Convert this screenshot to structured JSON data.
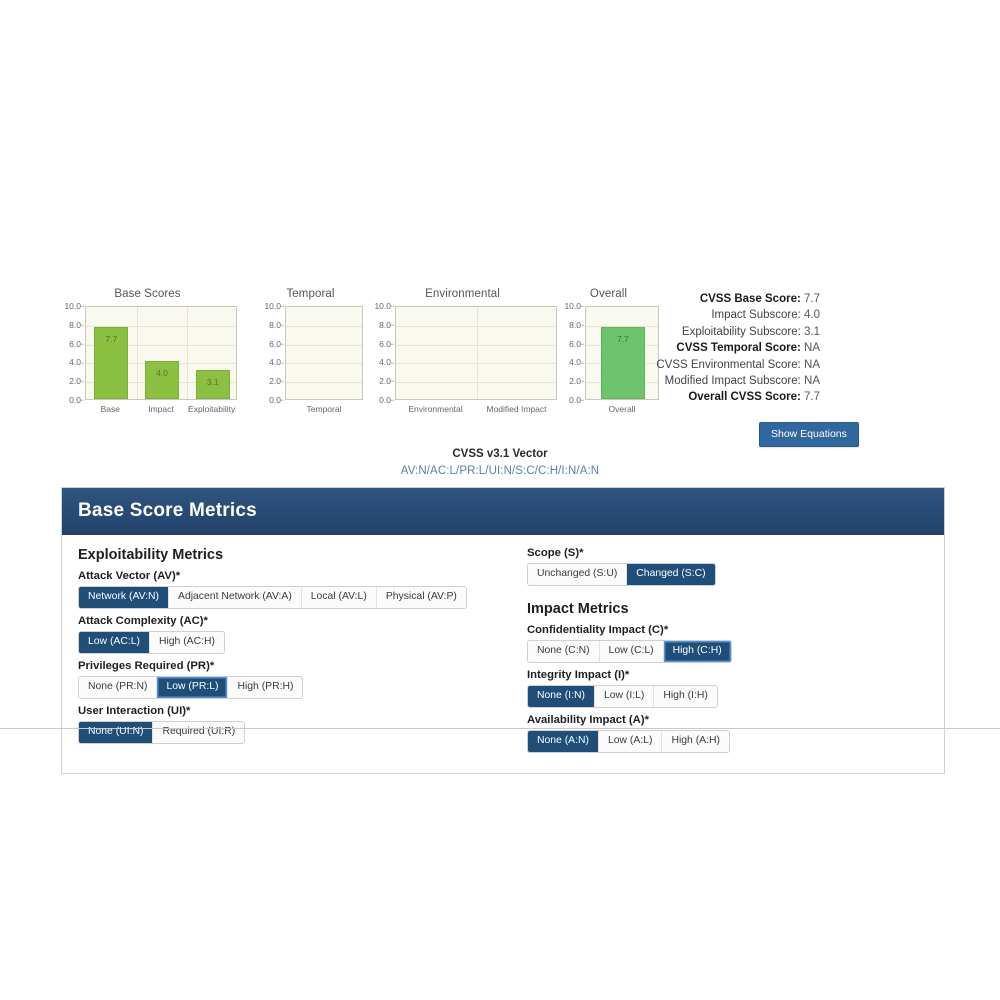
{
  "charts": {
    "yticks": [
      "10.0",
      "8.0",
      "6.0",
      "4.0",
      "2.0",
      "0.0"
    ],
    "panels": [
      {
        "title": "Base Scores",
        "categories": [
          "Base",
          "Impact",
          "Exploitability"
        ],
        "values": [
          7.7,
          4.0,
          3.1
        ],
        "labels": [
          "7.7",
          "4.0",
          "3.1"
        ]
      },
      {
        "title": "Temporal",
        "categories": [
          "Temporal"
        ],
        "values": [],
        "labels": []
      },
      {
        "title": "Environmental",
        "categories": [
          "Environmental",
          "Modified Impact"
        ],
        "values": [],
        "labels": []
      },
      {
        "title": "Overall",
        "categories": [
          "Overall"
        ],
        "values": [
          7.7
        ],
        "labels": [
          "7.7"
        ]
      }
    ]
  },
  "chart_data": [
    {
      "type": "bar",
      "title": "Base Scores",
      "categories": [
        "Base",
        "Impact",
        "Exploitability"
      ],
      "values": [
        7.7,
        4.0,
        3.1
      ],
      "xlabel": "",
      "ylabel": "",
      "ylim": [
        0,
        10
      ],
      "yticks": [
        0,
        2,
        4,
        6,
        8,
        10
      ],
      "grid": true,
      "legend": "none",
      "bar_color": "#8cc041",
      "data_labels": [
        "7.7",
        "4.0",
        "3.1"
      ]
    },
    {
      "type": "bar",
      "title": "Temporal",
      "categories": [
        "Temporal"
      ],
      "values": [],
      "xlabel": "",
      "ylabel": "",
      "ylim": [
        0,
        10
      ],
      "yticks": [
        0,
        2,
        4,
        6,
        8,
        10
      ],
      "grid": true,
      "legend": "none",
      "data_labels": []
    },
    {
      "type": "bar",
      "title": "Environmental",
      "categories": [
        "Environmental",
        "Modified Impact"
      ],
      "values": [],
      "xlabel": "",
      "ylabel": "",
      "ylim": [
        0,
        10
      ],
      "yticks": [
        0,
        2,
        4,
        6,
        8,
        10
      ],
      "grid": true,
      "legend": "none",
      "data_labels": []
    },
    {
      "type": "bar",
      "title": "Overall",
      "categories": [
        "Overall"
      ],
      "values": [
        7.7
      ],
      "xlabel": "",
      "ylabel": "",
      "ylim": [
        0,
        10
      ],
      "yticks": [
        0,
        2,
        4,
        6,
        8,
        10
      ],
      "grid": true,
      "legend": "none",
      "bar_color": "#6dc46d",
      "data_labels": [
        "7.7"
      ]
    }
  ],
  "scores": [
    {
      "label": "CVSS Base Score:",
      "value": "7.7",
      "bold": true
    },
    {
      "label": "Impact Subscore:",
      "value": "4.0",
      "bold": false
    },
    {
      "label": "Exploitability Subscore:",
      "value": "3.1",
      "bold": false
    },
    {
      "label": "CVSS Temporal Score:",
      "value": "NA",
      "bold": true
    },
    {
      "label": "CVSS Environmental Score:",
      "value": "NA",
      "bold": false
    },
    {
      "label": "Modified Impact Subscore:",
      "value": "NA",
      "bold": false
    },
    {
      "label": "Overall CVSS Score:",
      "value": "7.7",
      "bold": true
    }
  ],
  "show_equations_label": "Show Equations",
  "vector": {
    "title": "CVSS v3.1 Vector",
    "value": "AV:N/AC:L/PR:L/UI:N/S:C/C:H/I:N/A:N"
  },
  "panel": {
    "header": "Base Score Metrics",
    "left": {
      "section": "Exploitability Metrics",
      "metrics": [
        {
          "label": "Attack Vector (AV)*",
          "options": [
            {
              "text": "Network (AV:N)",
              "selected": true,
              "focused": false
            },
            {
              "text": "Adjacent Network (AV:A)",
              "selected": false,
              "focused": false
            },
            {
              "text": "Local (AV:L)",
              "selected": false,
              "focused": false
            },
            {
              "text": "Physical (AV:P)",
              "selected": false,
              "focused": false
            }
          ]
        },
        {
          "label": "Attack Complexity (AC)*",
          "options": [
            {
              "text": "Low (AC:L)",
              "selected": true,
              "focused": false
            },
            {
              "text": "High (AC:H)",
              "selected": false,
              "focused": false
            }
          ]
        },
        {
          "label": "Privileges Required (PR)*",
          "options": [
            {
              "text": "None (PR:N)",
              "selected": false,
              "focused": false
            },
            {
              "text": "Low (PR:L)",
              "selected": true,
              "focused": true
            },
            {
              "text": "High (PR:H)",
              "selected": false,
              "focused": false
            }
          ]
        },
        {
          "label": "User Interaction (UI)*",
          "options": [
            {
              "text": "None (UI:N)",
              "selected": true,
              "focused": false
            },
            {
              "text": "Required (UI:R)",
              "selected": false,
              "focused": false
            }
          ]
        }
      ]
    },
    "right": {
      "scope": {
        "label": "Scope (S)*",
        "options": [
          {
            "text": "Unchanged (S:U)",
            "selected": false,
            "focused": false
          },
          {
            "text": "Changed (S:C)",
            "selected": true,
            "focused": false
          }
        ]
      },
      "section": "Impact Metrics",
      "metrics": [
        {
          "label": "Confidentiality Impact (C)*",
          "options": [
            {
              "text": "None (C:N)",
              "selected": false,
              "focused": false
            },
            {
              "text": "Low (C:L)",
              "selected": false,
              "focused": false
            },
            {
              "text": "High (C:H)",
              "selected": true,
              "focused": true
            }
          ]
        },
        {
          "label": "Integrity Impact (I)*",
          "options": [
            {
              "text": "None (I:N)",
              "selected": true,
              "focused": false
            },
            {
              "text": "Low (I:L)",
              "selected": false,
              "focused": false
            },
            {
              "text": "High (I:H)",
              "selected": false,
              "focused": false
            }
          ]
        },
        {
          "label": "Availability Impact (A)*",
          "options": [
            {
              "text": "None (A:N)",
              "selected": true,
              "focused": false
            },
            {
              "text": "Low (A:L)",
              "selected": false,
              "focused": false
            },
            {
              "text": "High (A:H)",
              "selected": false,
              "focused": false
            }
          ]
        }
      ]
    }
  }
}
